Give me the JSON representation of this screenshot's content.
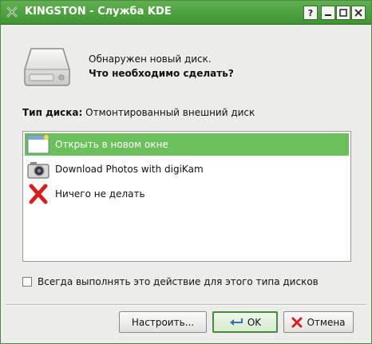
{
  "window": {
    "title": "KINGSTON - Служба KDE",
    "controls": {
      "help": "?",
      "minimize": "_",
      "maximize": "□",
      "close": "✕"
    }
  },
  "message": {
    "line1": "Обнаружен новый диск.",
    "line2": "Что необходимо сделать?"
  },
  "disk_type": {
    "label": "Тип диска:",
    "value": "Отмонтированный внешний диск"
  },
  "actions": [
    {
      "label": "Открыть в новом окне",
      "icon": "window-icon",
      "selected": true
    },
    {
      "label": "Download Photos with digiKam",
      "icon": "camera-icon",
      "selected": false
    },
    {
      "label": "Ничего не делать",
      "icon": "red-x-icon",
      "selected": false
    }
  ],
  "always_checkbox": {
    "label": "Всегда выполнять это действие для этого типа дисков",
    "checked": false
  },
  "buttons": {
    "configure": "Настроить...",
    "ok": "OK",
    "cancel": "Отмена"
  },
  "colors": {
    "titlebar": "#4fa242",
    "selection": "#6cc05c",
    "cancel_icon": "#d81e1e"
  }
}
